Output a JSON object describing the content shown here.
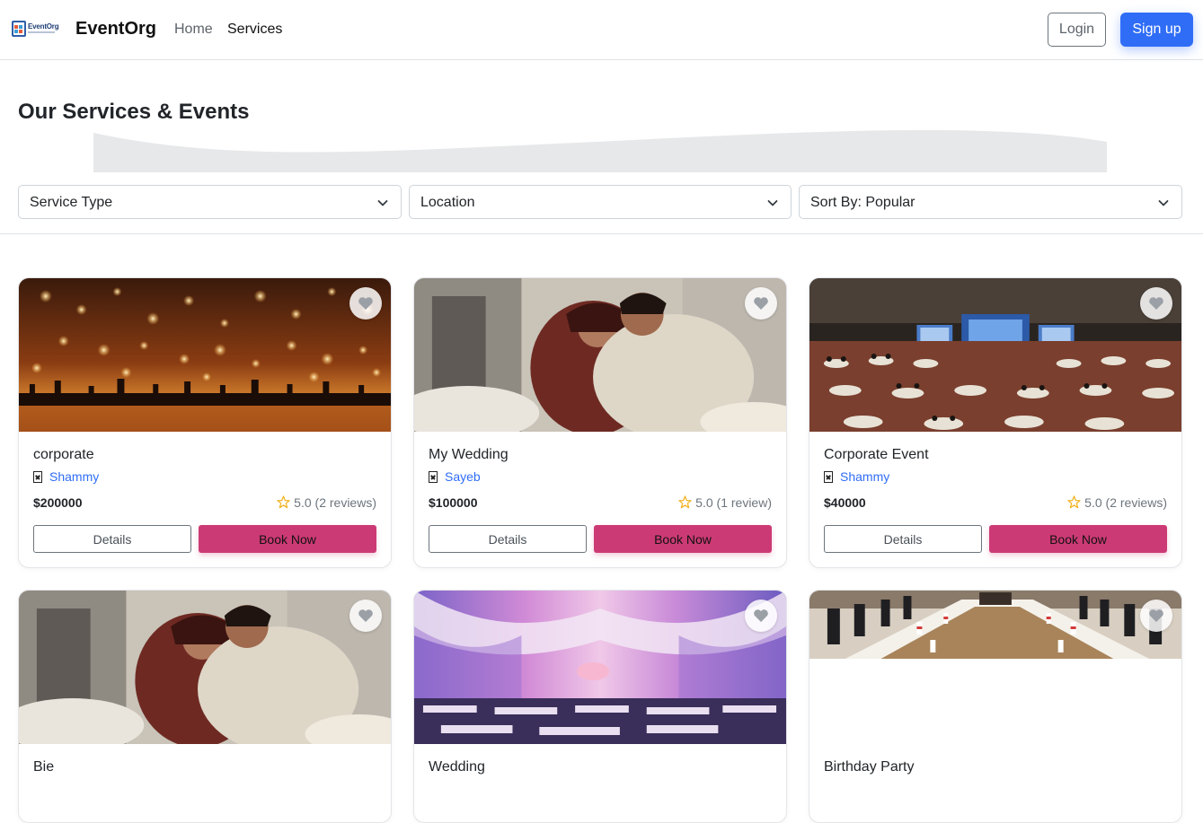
{
  "nav": {
    "logo_text": "EventOrg",
    "brand": "EventOrg",
    "links": [
      "Home",
      "Services"
    ],
    "login": "Login",
    "signup": "Sign up"
  },
  "page": {
    "title": "Our Services & Events"
  },
  "filters": {
    "service_type": "Service Type",
    "location": "Location",
    "sort_by": "Sort By: Popular"
  },
  "services": [
    {
      "title": "corporate",
      "owner": "Shammy",
      "price": "$200000",
      "rating": "5.0",
      "reviews": "(2 reviews)",
      "details": "Details",
      "book": "Book Now",
      "image": "lanterns-night"
    },
    {
      "title": "My Wedding",
      "owner": "Sayeb",
      "price": "$100000",
      "rating": "5.0",
      "reviews": "(1 review)",
      "details": "Details",
      "book": "Book Now",
      "image": "wedding-couple"
    },
    {
      "title": "Corporate Event",
      "owner": "Shammy",
      "price": "$40000",
      "rating": "5.0",
      "reviews": "(2 reviews)",
      "details": "Details",
      "book": "Book Now",
      "image": "conference-hall"
    },
    {
      "title": "Bie",
      "image": "wedding-couple"
    },
    {
      "title": "Wedding",
      "image": "wedding-hall"
    },
    {
      "title": "Birthday Party",
      "image": "meeting-room"
    }
  ],
  "colors": {
    "primary": "#2f6df6",
    "book_now": "#cc3a75",
    "owner_link": "#2f6df6",
    "star": "#f2b01e"
  }
}
